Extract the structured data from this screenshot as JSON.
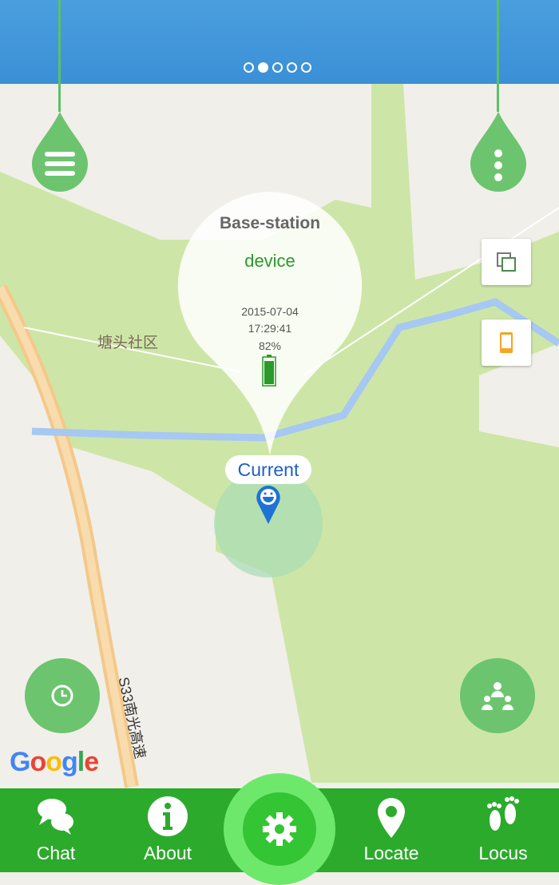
{
  "banner": {
    "slide_count": 5,
    "active_slide": 2
  },
  "map": {
    "district_label": "塘头社区",
    "road_label": "S33南光高速",
    "attribution": "Google"
  },
  "popup": {
    "title": "Base-station",
    "device": "device",
    "date": "2015-07-04",
    "time": "17:29:41",
    "battery": "82%",
    "battery_level": 0.82
  },
  "marker": {
    "label": "Current"
  },
  "colors": {
    "primary": "#2caa2c",
    "accent": "#6cc46f",
    "device_text": "#2b9a2b",
    "current_text": "#1e5fc4"
  },
  "nav": {
    "items": [
      {
        "label": "Chat",
        "icon": "chat-icon"
      },
      {
        "label": "About",
        "icon": "info-icon"
      },
      {
        "label": "",
        "icon": "gear-icon"
      },
      {
        "label": "Locate",
        "icon": "location-pin-icon"
      },
      {
        "label": "Locus",
        "icon": "footprints-icon"
      }
    ]
  }
}
